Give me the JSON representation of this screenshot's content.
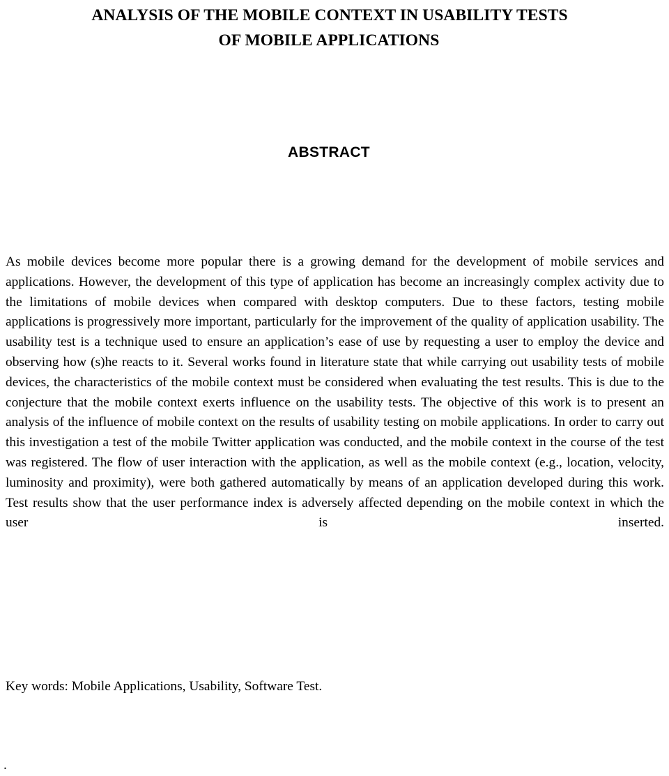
{
  "document": {
    "title_lines": [
      "ANALYSIS OF THE MOBILE CONTEXT IN USABILITY TESTS",
      "OF MOBILE APPLICATIONS"
    ],
    "section_heading": "ABSTRACT",
    "abstract_text": "As mobile devices become more popular there is a growing demand for the development of mobile services and applications. However, the development of this type of application has become an increasingly complex activity due to the limitations of mobile devices when compared with desktop computers. Due to these factors, testing mobile applications is progressively more important, particularly for the improvement of the quality of application usability. The usability test is a technique used to ensure an application’s ease of use by requesting a user to employ the device and observing how (s)he reacts to it. Several works found in literature state that while carrying out usability tests of mobile devices, the characteristics of the mobile context must be considered when evaluating the test results. This is due to the conjecture that the mobile context exerts influence on the usability tests. The objective of this work is to present an analysis of the influence of mobile context on the results of usability testing on mobile applications. In order to carry out this investigation a test of the mobile Twitter application was conducted, and the mobile context in the course of the test was registered. The flow of user interaction with the application, as well as the mobile context (e.g., location, velocity, luminosity and proximity), were both gathered automatically by means of an application developed during this work. Test results show that the user performance index is adversely affected depending on the mobile context in which the user is inserted.",
    "keywords_line": "Key words: Mobile Applications, Usability, Software Test.",
    "trailing_mark": ".",
    "colors": {
      "page_background": "#ffffff",
      "text": "#000000"
    }
  }
}
